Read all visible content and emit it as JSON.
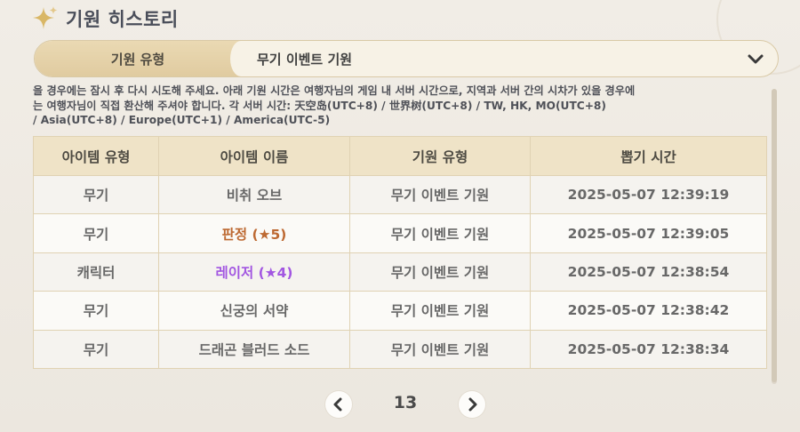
{
  "header": {
    "title": "기원 히스토리"
  },
  "filter": {
    "label": "기원 유형",
    "selected": "무기 이벤트 기원"
  },
  "notice": {
    "lines": [
      "을 경우에는 잠시 후 다시 시도해 주세요. 아래 기원 시간은 여행자님의 게임 내 서버 시간으로, 지역과 서버 간의 시차가 있을 경우에",
      "는 여행자님이 직접 환산해 주셔야 합니다. 각 서버 시간: 天空岛(UTC+8) / 世界树(UTC+8) / TW, HK, MO(UTC+8)",
      "/ Asia(UTC+8) / Europe(UTC+1) / America(UTC-5)"
    ]
  },
  "table": {
    "columns": [
      "아이템 유형",
      "아이템 이름",
      "기원 유형",
      "뽑기 시간"
    ],
    "rows": [
      {
        "type": "무기",
        "name": "비취 오브",
        "banner": "무기 이벤트 기원",
        "time": "2025-05-07 12:39:19",
        "rarity": "3"
      },
      {
        "type": "무기",
        "name": "판정 (★5)",
        "banner": "무기 이벤트 기원",
        "time": "2025-05-07 12:39:05",
        "rarity": "5"
      },
      {
        "type": "캐릭터",
        "name": "레이저 (★4)",
        "banner": "무기 이벤트 기원",
        "time": "2025-05-07 12:38:54",
        "rarity": "4"
      },
      {
        "type": "무기",
        "name": "신궁의 서약",
        "banner": "무기 이벤트 기원",
        "time": "2025-05-07 12:38:42",
        "rarity": "3"
      },
      {
        "type": "무기",
        "name": "드래곤 블러드 소드",
        "banner": "무기 이벤트 기원",
        "time": "2025-05-07 12:38:34",
        "rarity": "3"
      }
    ]
  },
  "pagination": {
    "page": "13"
  },
  "icons": {
    "title": "sparkle-icon",
    "select": "chevron-down-icon",
    "prev": "chevron-left-icon",
    "next": "chevron-right-icon"
  },
  "colors": {
    "rarity_5": "#bd6932",
    "rarity_4": "#a256e1",
    "header_bg": "#efe3c7",
    "border": "#e0d2b3"
  }
}
